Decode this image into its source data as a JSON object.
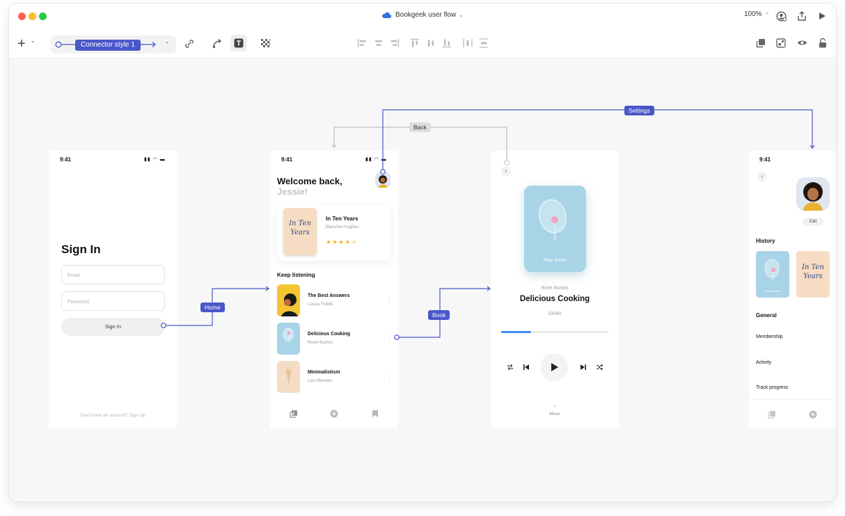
{
  "window": {
    "title": "Bookgeek user flow",
    "zoom": "100%"
  },
  "toolbar": {
    "add_label": "+",
    "connector_style": "Connector style 1"
  },
  "connectors": {
    "home": "Home",
    "book": "Book",
    "back": "Back",
    "settings": "Settings"
  },
  "signin": {
    "time": "9:41",
    "heading": "Sign In",
    "email_placeholder": "Email",
    "password_placeholder": "Password",
    "button": "Sign In",
    "footer": "Don't have an account? Sign Up"
  },
  "home": {
    "time": "9:41",
    "welcome": "Welcome back,",
    "name": "Jessie!",
    "featured": {
      "title": "In Ten Years",
      "author": "Blanche Hughes",
      "rating": 4,
      "cover_text": "In Ten Years"
    },
    "section": "Keep listening",
    "items": [
      {
        "title": "The Best Answers",
        "author": "Lucas Fields"
      },
      {
        "title": "Delicious Cooking",
        "author": "Rose Burton"
      },
      {
        "title": "Minimalistism",
        "author": "Leo Mendez"
      }
    ]
  },
  "player": {
    "cover_author": "Rose Burton",
    "author": "Rose Burton",
    "title": "Delicious Cooking",
    "progress_text": "23/40",
    "progress": 0.28,
    "more": "More"
  },
  "profile": {
    "time": "9:41",
    "edit": "Edit",
    "history": "History",
    "history_cover_author": "Rose Burton",
    "history_cover2": "In Ten Years",
    "general": "General",
    "menu": [
      "Membership",
      "Activity",
      "Track progress"
    ]
  },
  "colors": {
    "accent": "#4a57c9",
    "progress": "#3d8ef5",
    "star": "#f5b728",
    "cover_blue": "#a9d3e6",
    "cover_peach": "#f6dcc2"
  }
}
